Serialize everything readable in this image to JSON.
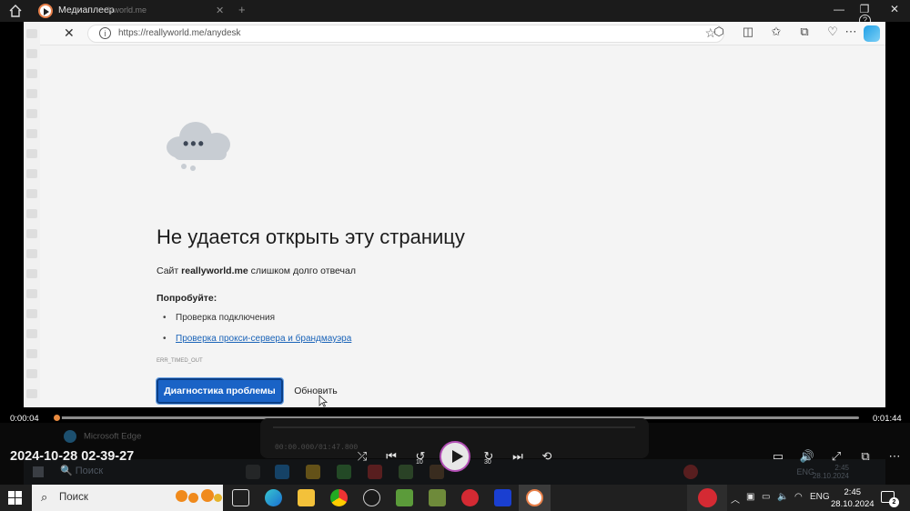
{
  "window": {
    "app_title": "Медиаплеер",
    "ghost_tab_text": "lyworld.me",
    "controls": {
      "minimize": "—",
      "restore": "❐",
      "close": "✕"
    }
  },
  "browser": {
    "url": "https://reallyworld.me/anydesk",
    "close_glyph": "✕",
    "star_glyph": "☆"
  },
  "error_page": {
    "title": "Не удается открыть эту страницу",
    "subtitle_prefix": "Сайт ",
    "subtitle_site": "reallyworld.me",
    "subtitle_suffix": " слишком долго отвечал",
    "try_heading": "Попробуйте:",
    "tips": [
      "Проверка подключения",
      "Проверка прокси-сервера и брандмауэра"
    ],
    "error_code": "ERR_TIMED_OUT",
    "diagnose_button": "Диагностика проблемы",
    "reload_button": "Обновить"
  },
  "playback": {
    "current_time": "0:00:04",
    "total_time": "0:01:44",
    "progress_fraction": 0.0,
    "recording_timestamp": "2024-10-28 02-39-27",
    "skip_back_label": "10",
    "skip_forward_label": "30"
  },
  "ghost_desktop": {
    "edge_label": "Microsoft Edge",
    "mini_time": "00:00.000/01:47.800",
    "search": "Поиск",
    "lang": "ENG",
    "time": "2:45",
    "date": "28.10.2024"
  },
  "taskbar": {
    "search_placeholder": "Поиск",
    "lang": "ENG",
    "time": "2:45",
    "date": "28.10.2024",
    "notification_count": "2"
  },
  "colors": {
    "accent_orange": "#e98a3f",
    "button_blue": "#1a63c6",
    "link_blue": "#1a63b8"
  }
}
